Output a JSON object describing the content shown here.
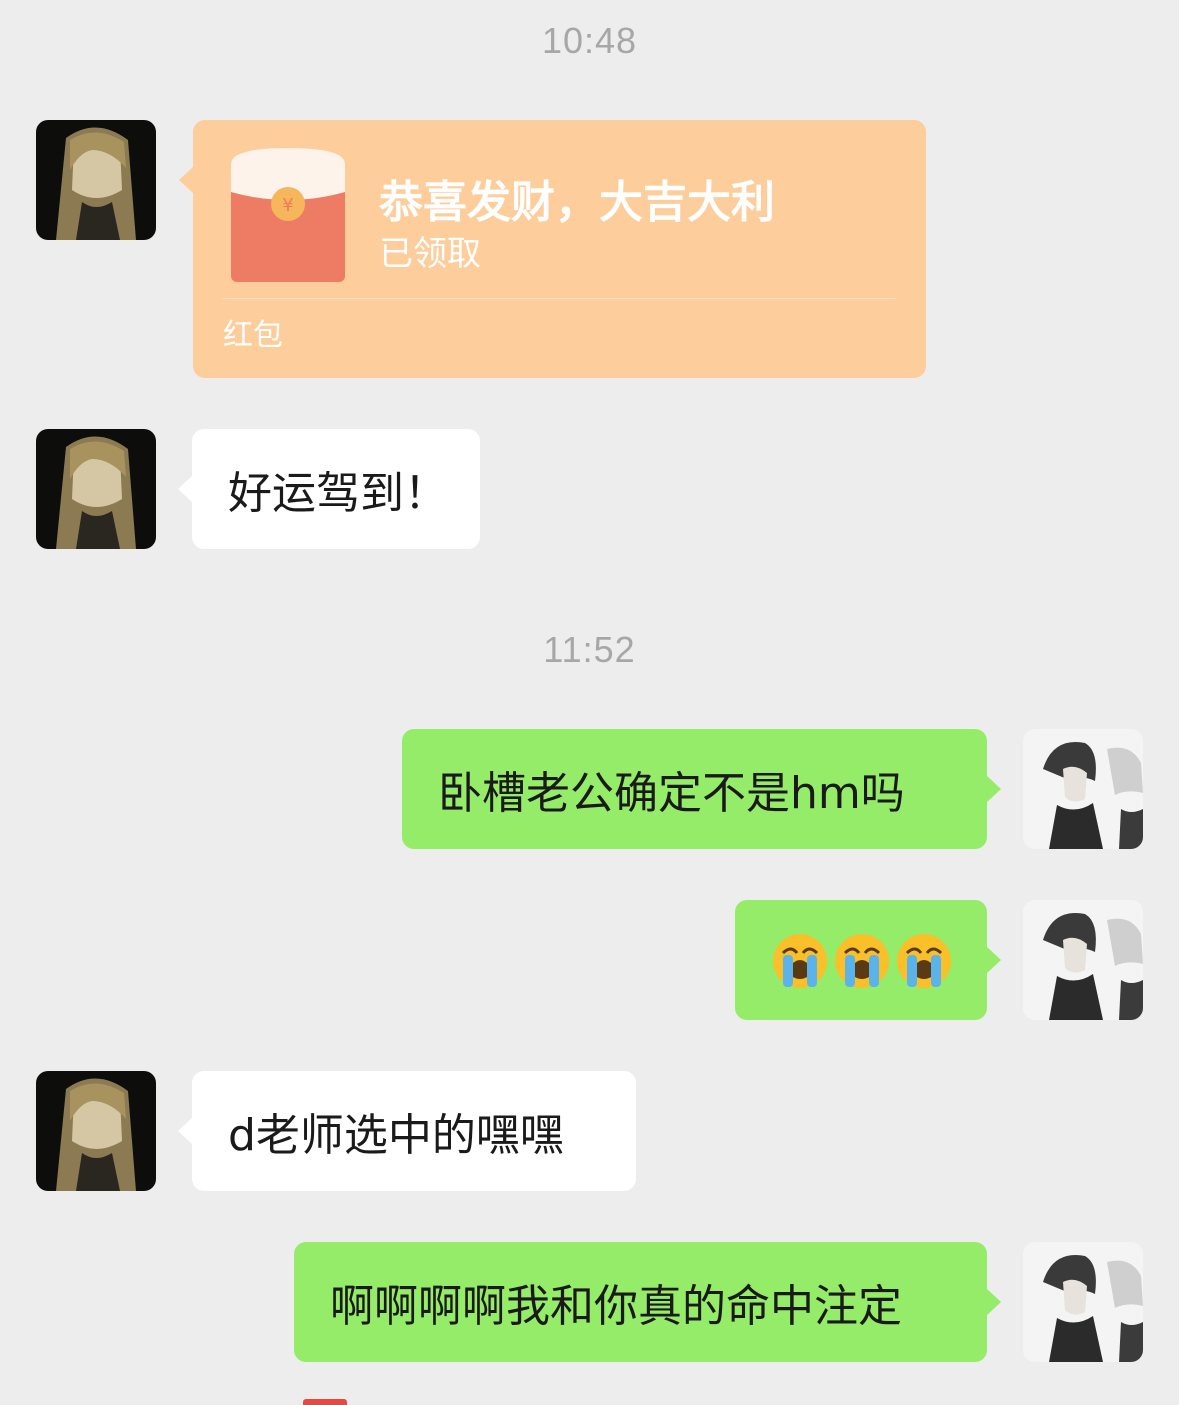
{
  "timestamps": [
    "10:48",
    "11:52"
  ],
  "messages": {
    "red_packet": {
      "title": "恭喜发财，大吉大利",
      "status": "已领取",
      "label": "红包",
      "color": "#fdcd9b"
    },
    "m1": "好运驾到！",
    "m2": "卧槽老公确定不是hm吗",
    "m3_emoji": "loudly-crying-face x3",
    "m4": "d老师选中的嘿嘿",
    "m5": "啊啊啊啊我和你真的命中注定"
  },
  "colors": {
    "background": "#ededed",
    "incoming_bubble": "#ffffff",
    "outgoing_bubble": "#95ec69",
    "timestamp": "#a7a7a7"
  }
}
